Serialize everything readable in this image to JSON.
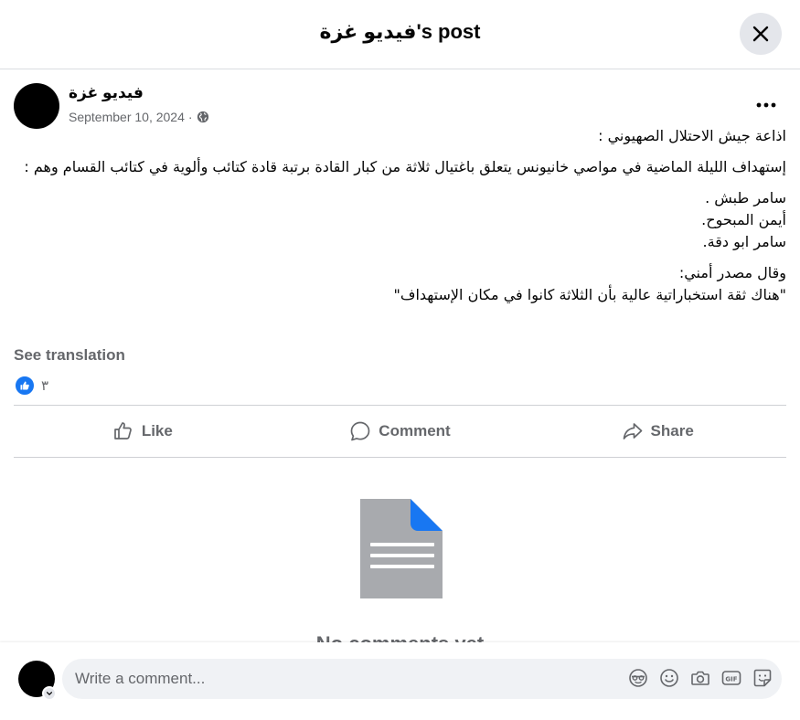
{
  "header": {
    "title": "فيديو غزة's post",
    "close_icon": "close-icon"
  },
  "post": {
    "author": "فيديو غزة",
    "date": "September 10, 2024",
    "date_separator": "·",
    "privacy_icon": "globe-icon",
    "more_icon": "more-horizontal-icon",
    "paragraphs": [
      [
        "اذاعة جيش الاحتلال الصهيوني :"
      ],
      [
        "إستهداف الليلة الماضية في مواصي خانيونس يتعلق باغتيال ثلاثة من كبار القادة برتبة قادة كتائب وألوية في كتائب القسام وهم :"
      ],
      [
        "سامر طبش .",
        "أيمن المبحوح.",
        "سامر ابو دقة."
      ],
      [
        "وقال مصدر أمني:",
        "\"هناك ثقة استخباراتية عالية بأن الثلاثة كانوا في مكان الإستهداف\""
      ]
    ],
    "see_translation": "See translation",
    "reaction_count": "٣",
    "reaction_icon": "like-reaction-icon"
  },
  "actions": {
    "like": "Like",
    "comment": "Comment",
    "share": "Share"
  },
  "comments": {
    "empty_icon": "document-icon",
    "empty_text": "No comments yet"
  },
  "composer": {
    "placeholder": "Write a comment...",
    "tools": [
      "avatar-sticker-icon",
      "emoji-icon",
      "camera-icon",
      "gif-icon",
      "sticker-icon"
    ]
  },
  "colors": {
    "accent": "#1877f2",
    "secondary_text": "#65676b",
    "divider": "#ced0d4",
    "input_bg": "#f0f2f5",
    "doc_gray": "#a8aaae"
  }
}
